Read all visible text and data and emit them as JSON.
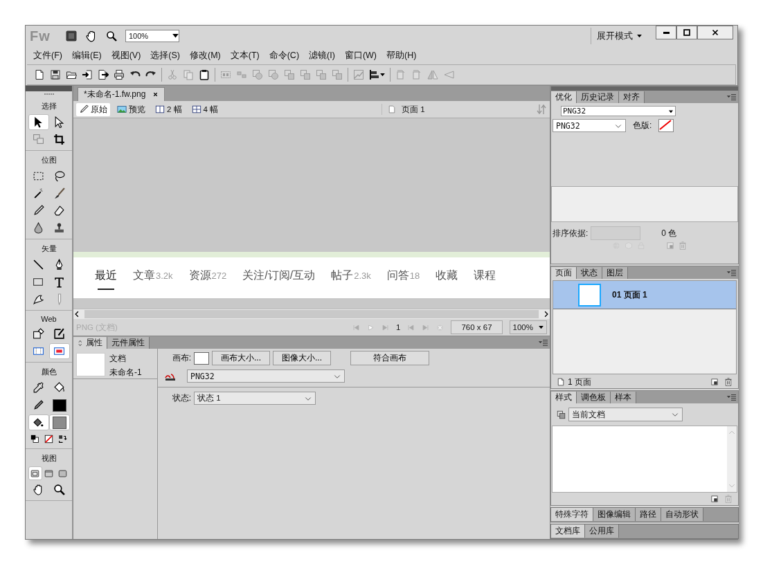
{
  "title_bar": {
    "logo": "Fw",
    "zoom": "100%",
    "workspace": "展开模式"
  },
  "menu": [
    "文件(F)",
    "编辑(E)",
    "视图(V)",
    "选择(S)",
    "修改(M)",
    "文本(T)",
    "命令(C)",
    "滤镜(I)",
    "窗口(W)",
    "帮助(H)"
  ],
  "main_toolbar": [
    {
      "disabled": false
    },
    {
      "disabled": false
    },
    {
      "disabled": false
    },
    {
      "disabled": false
    },
    {
      "disabled": false
    },
    {
      "disabled": false
    },
    {
      "disabled": false
    },
    {
      "disabled": false
    },
    {
      "disabled": true
    },
    {
      "disabled": true
    },
    {
      "disabled": false
    },
    {
      "disabled": true
    },
    {
      "disabled": true
    },
    {
      "disabled": true
    },
    {
      "disabled": true
    },
    {
      "disabled": true
    },
    {
      "disabled": true
    },
    {
      "disabled": true
    },
    {
      "disabled": true
    },
    {
      "disabled": true
    },
    {
      "disabled": false
    },
    {
      "disabled": true
    },
    {
      "disabled": true
    },
    {
      "disabled": true
    },
    {
      "disabled": true
    }
  ],
  "tools": [
    {
      "title": "选择",
      "items": [
        {
          "kind": "tool",
          "selected": true
        },
        {
          "kind": "tool",
          "selected": false
        },
        {
          "kind": "tool",
          "selected": false
        },
        {
          "kind": "tool",
          "selected": false
        }
      ]
    },
    {
      "title": "位图",
      "items": [
        {
          "kind": "tool",
          "selected": false
        },
        {
          "kind": "tool",
          "selected": false
        },
        {
          "kind": "tool",
          "selected": false
        },
        {
          "kind": "tool",
          "selected": false
        },
        {
          "kind": "tool",
          "selected": false
        },
        {
          "kind": "tool",
          "selected": false
        },
        {
          "kind": "tool",
          "selected": false
        },
        {
          "kind": "tool",
          "selected": false
        }
      ]
    },
    {
      "title": "矢量",
      "items": [
        {
          "kind": "tool",
          "selected": false
        },
        {
          "kind": "tool",
          "selected": false
        },
        {
          "kind": "tool",
          "selected": false
        },
        {
          "kind": "tool",
          "selected": false
        },
        {
          "kind": "tool",
          "selected": false
        },
        {
          "kind": "tool",
          "selected": false
        }
      ]
    },
    {
      "title": "Web",
      "items": [
        {
          "kind": "tool",
          "selected": false
        },
        {
          "kind": "tool",
          "selected": false
        },
        {
          "kind": "tool",
          "selected": false
        },
        {
          "kind": "tool",
          "selected": true
        }
      ]
    },
    {
      "title": "颜色",
      "items": [
        {
          "kind": "tool",
          "selected": false
        },
        {
          "kind": "tool",
          "selected": false
        },
        {
          "kind": "tool",
          "selected": false
        },
        {
          "kind": "swatch",
          "color": "#000000",
          "selected": false
        },
        {
          "kind": "tool",
          "selected": true
        },
        {
          "kind": "swatch",
          "color": "#8c8c8c",
          "selected": true
        },
        {
          "kind": "mini",
          "selected": false
        },
        {
          "kind": "mini",
          "selected": false
        },
        {
          "kind": "mini",
          "selected": false
        }
      ]
    },
    {
      "title": "视图",
      "items": [
        {
          "kind": "mini",
          "selected": true
        },
        {
          "kind": "mini",
          "selected": false
        },
        {
          "kind": "mini",
          "selected": false
        },
        {
          "kind": "tool",
          "selected": false
        },
        {
          "kind": "tool",
          "selected": false
        }
      ]
    }
  ],
  "document": {
    "tab": "*未命名-1.fw.png",
    "view_modes": [
      {
        "label": "原始",
        "selected": true
      },
      {
        "label": "预览",
        "selected": false
      },
      {
        "label": "2 幅",
        "selected": false
      },
      {
        "label": "4 幅",
        "selected": false
      }
    ],
    "page": "页面 1"
  },
  "canvas": {
    "nav": [
      {
        "label": "最近",
        "selected": true
      },
      {
        "label": "文章",
        "count": "3.2k",
        "selected": false
      },
      {
        "label": "资源",
        "count": "272",
        "selected": false
      },
      {
        "label": "关注/订阅/互动",
        "selected": false
      },
      {
        "label": "帖子",
        "count": "2.3k",
        "selected": false
      },
      {
        "label": "问答",
        "count": "18",
        "selected": false
      },
      {
        "label": "收藏",
        "selected": false
      },
      {
        "label": "课程",
        "selected": false
      }
    ]
  },
  "status_bar": {
    "format": "PNG (文档)",
    "frame": "1",
    "size": "760 x 67",
    "zoom": "100%"
  },
  "properties": {
    "tabs": [
      {
        "label": "属性",
        "selected": true
      },
      {
        "label": "元件属性",
        "selected": false
      }
    ],
    "doc_type": "文档",
    "doc_name": "未命名-1",
    "canvas_label": "画布:",
    "buttons": [
      "画布大小...",
      "图像大小...",
      "符合画布"
    ],
    "format": "PNG32",
    "state_label": "状态:",
    "state": "状态 1"
  },
  "optimize_panel": {
    "tabs": [
      {
        "label": "优化",
        "selected": true
      },
      {
        "label": "历史记录",
        "selected": false
      },
      {
        "label": "对齐",
        "selected": false
      }
    ],
    "preset": "PNG32",
    "format": "PNG32",
    "matte_label": "色版:",
    "sort_label": "排序依据:",
    "colors": "0 色"
  },
  "pages_panel": {
    "tabs": [
      {
        "label": "页面",
        "selected": true
      },
      {
        "label": "状态",
        "selected": false
      },
      {
        "label": "图层",
        "selected": false
      }
    ],
    "pages": [
      {
        "label": "01 页面 1",
        "selected": true
      }
    ],
    "count": "1 页面"
  },
  "styles_panel": {
    "tabs": [
      {
        "label": "样式",
        "selected": true
      },
      {
        "label": "调色板",
        "selected": false
      },
      {
        "label": "样本",
        "selected": false
      }
    ],
    "library": "当前文档"
  },
  "collapsed_panels": [
    {
      "tabs": [
        {
          "label": "特殊字符",
          "selected": true
        },
        {
          "label": "图像编辑",
          "selected": false
        },
        {
          "label": "路径",
          "selected": false
        },
        {
          "label": "自动形状",
          "selected": false
        }
      ]
    },
    {
      "tabs": [
        {
          "label": "文档库",
          "selected": true
        },
        {
          "label": "公用库",
          "selected": false
        }
      ]
    }
  ]
}
